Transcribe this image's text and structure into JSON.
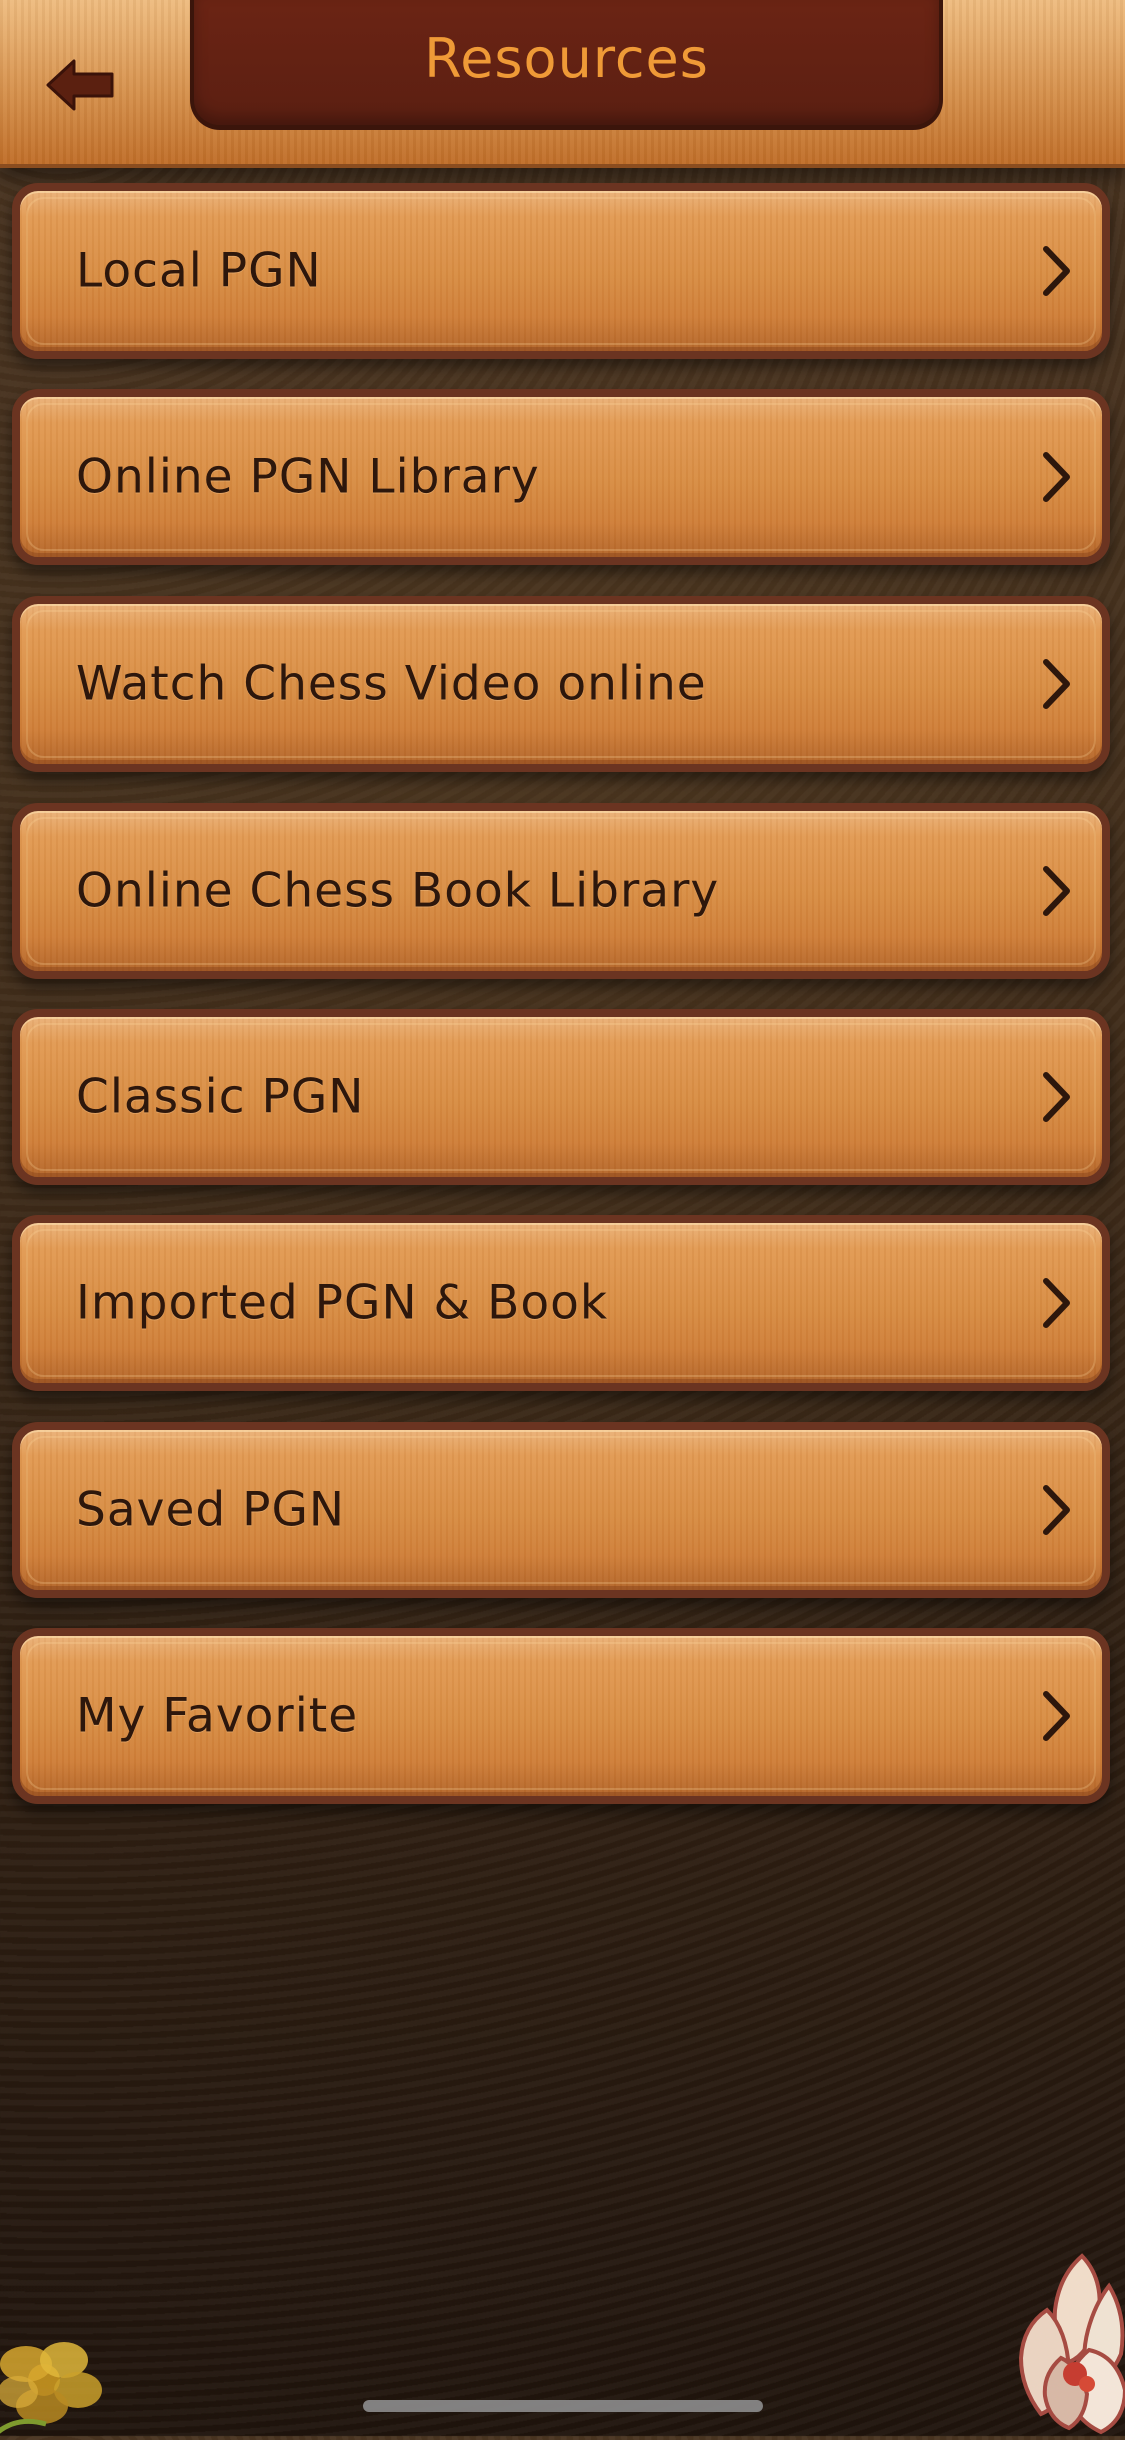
{
  "header": {
    "title": "Resources",
    "back_icon": "back-arrow-icon"
  },
  "menu": {
    "items": [
      {
        "label": "Local PGN",
        "icon": "chevron-right-icon"
      },
      {
        "label": "Online PGN Library",
        "icon": "chevron-right-icon"
      },
      {
        "label": "Watch Chess Video online",
        "icon": "chevron-right-icon"
      },
      {
        "label": "Online Chess Book Library",
        "icon": "chevron-right-icon"
      },
      {
        "label": "Classic PGN",
        "icon": "chevron-right-icon"
      },
      {
        "label": "Imported PGN & Book",
        "icon": "chevron-right-icon"
      },
      {
        "label": "Saved PGN",
        "icon": "chevron-right-icon"
      },
      {
        "label": "My Favorite",
        "icon": "chevron-right-icon"
      }
    ]
  },
  "colors": {
    "title_text": "#ef9a37",
    "menu_text": "#2d170c",
    "header_wood": "#d98f45",
    "title_plate": "#5b1f12",
    "menu_wood": "#d88d43",
    "menu_border": "#6b3421",
    "background_dark": "#2d1e12"
  }
}
